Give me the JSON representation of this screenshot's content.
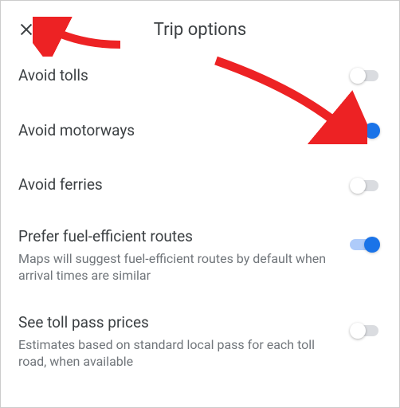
{
  "header": {
    "title": "Trip options"
  },
  "options": [
    {
      "label": "Avoid tolls",
      "desc": "",
      "on": false
    },
    {
      "label": "Avoid motorways",
      "desc": "",
      "on": true
    },
    {
      "label": "Avoid ferries",
      "desc": "",
      "on": false
    },
    {
      "label": "Prefer fuel-efficient routes",
      "desc": "Maps will suggest fuel-efficient routes by default when arrival times are similar",
      "on": true
    },
    {
      "label": "See toll pass prices",
      "desc": "Estimates based on standard local pass for each toll road, when available",
      "on": false
    }
  ]
}
